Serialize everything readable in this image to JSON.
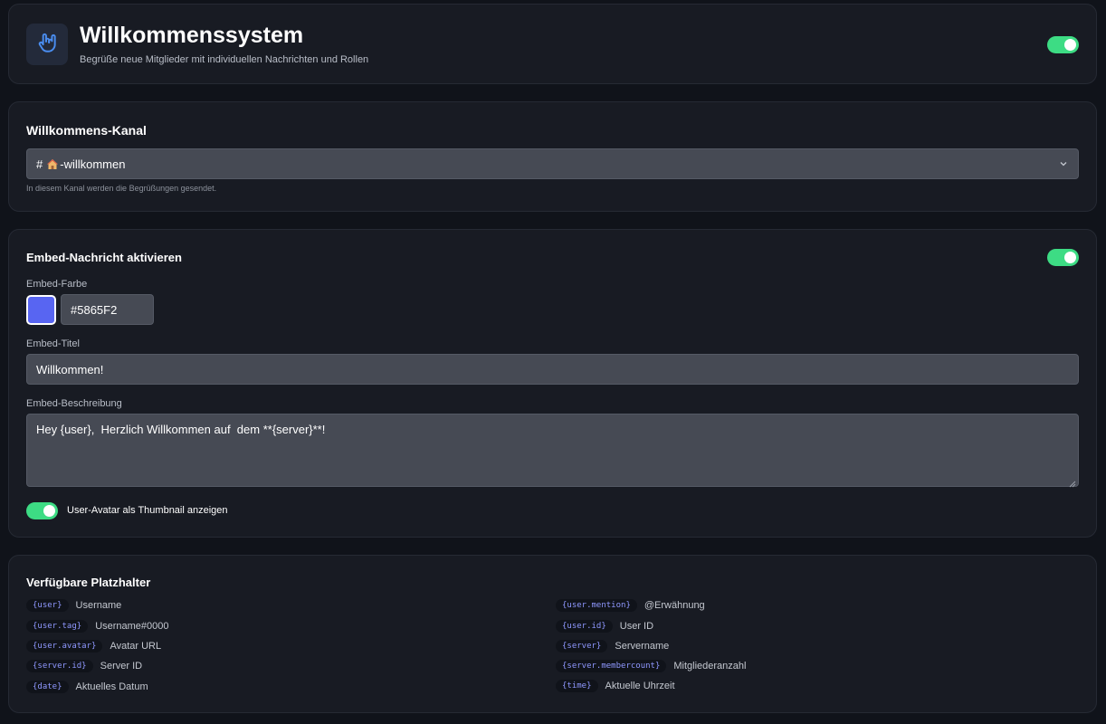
{
  "header": {
    "title": "Willkommenssystem",
    "subtitle": "Begrüße neue Mitglieder mit individuellen Nachrichten und Rollen",
    "enabled": true,
    "logo_icon": "hand-rock-icon"
  },
  "channel": {
    "title": "Willkommens-Kanal",
    "selected_prefix": "#",
    "selected_name": "-willkommen",
    "hint": "In diesem Kanal werden die Begrüßungen gesendet."
  },
  "embed": {
    "title": "Embed-Nachricht aktivieren",
    "enabled": true,
    "color_label": "Embed-Farbe",
    "color_value": "#5865F2",
    "title_label": "Embed-Titel",
    "title_value": "Willkommen!",
    "description_label": "Embed-Beschreibung",
    "description_value": "Hey {user},  Herzlich Willkommen auf  dem **{server}**!",
    "thumbnail_label": "User-Avatar als Thumbnail anzeigen",
    "thumbnail_enabled": true
  },
  "placeholders": {
    "title": "Verfügbare Platzhalter",
    "items": [
      {
        "code": "{user}",
        "desc": "Username"
      },
      {
        "code": "{user.mention}",
        "desc": "@Erwähnung"
      },
      {
        "code": "{user.tag}",
        "desc": "Username#0000"
      },
      {
        "code": "{user.id}",
        "desc": "User ID"
      },
      {
        "code": "{user.avatar}",
        "desc": "Avatar URL"
      },
      {
        "code": "{server}",
        "desc": "Servername"
      },
      {
        "code": "{server.id}",
        "desc": "Server ID"
      },
      {
        "code": "{server.membercount}",
        "desc": "Mitgliederanzahl"
      },
      {
        "code": "{date}",
        "desc": "Aktuelles Datum"
      },
      {
        "code": "{time}",
        "desc": "Aktuelle Uhrzeit"
      }
    ]
  },
  "colors": {
    "accent_green": "#3ddc84",
    "embed_color": "#5865F2",
    "background": "#10131a",
    "card": "#181b23",
    "placeholder_code": "#8f98ff"
  }
}
